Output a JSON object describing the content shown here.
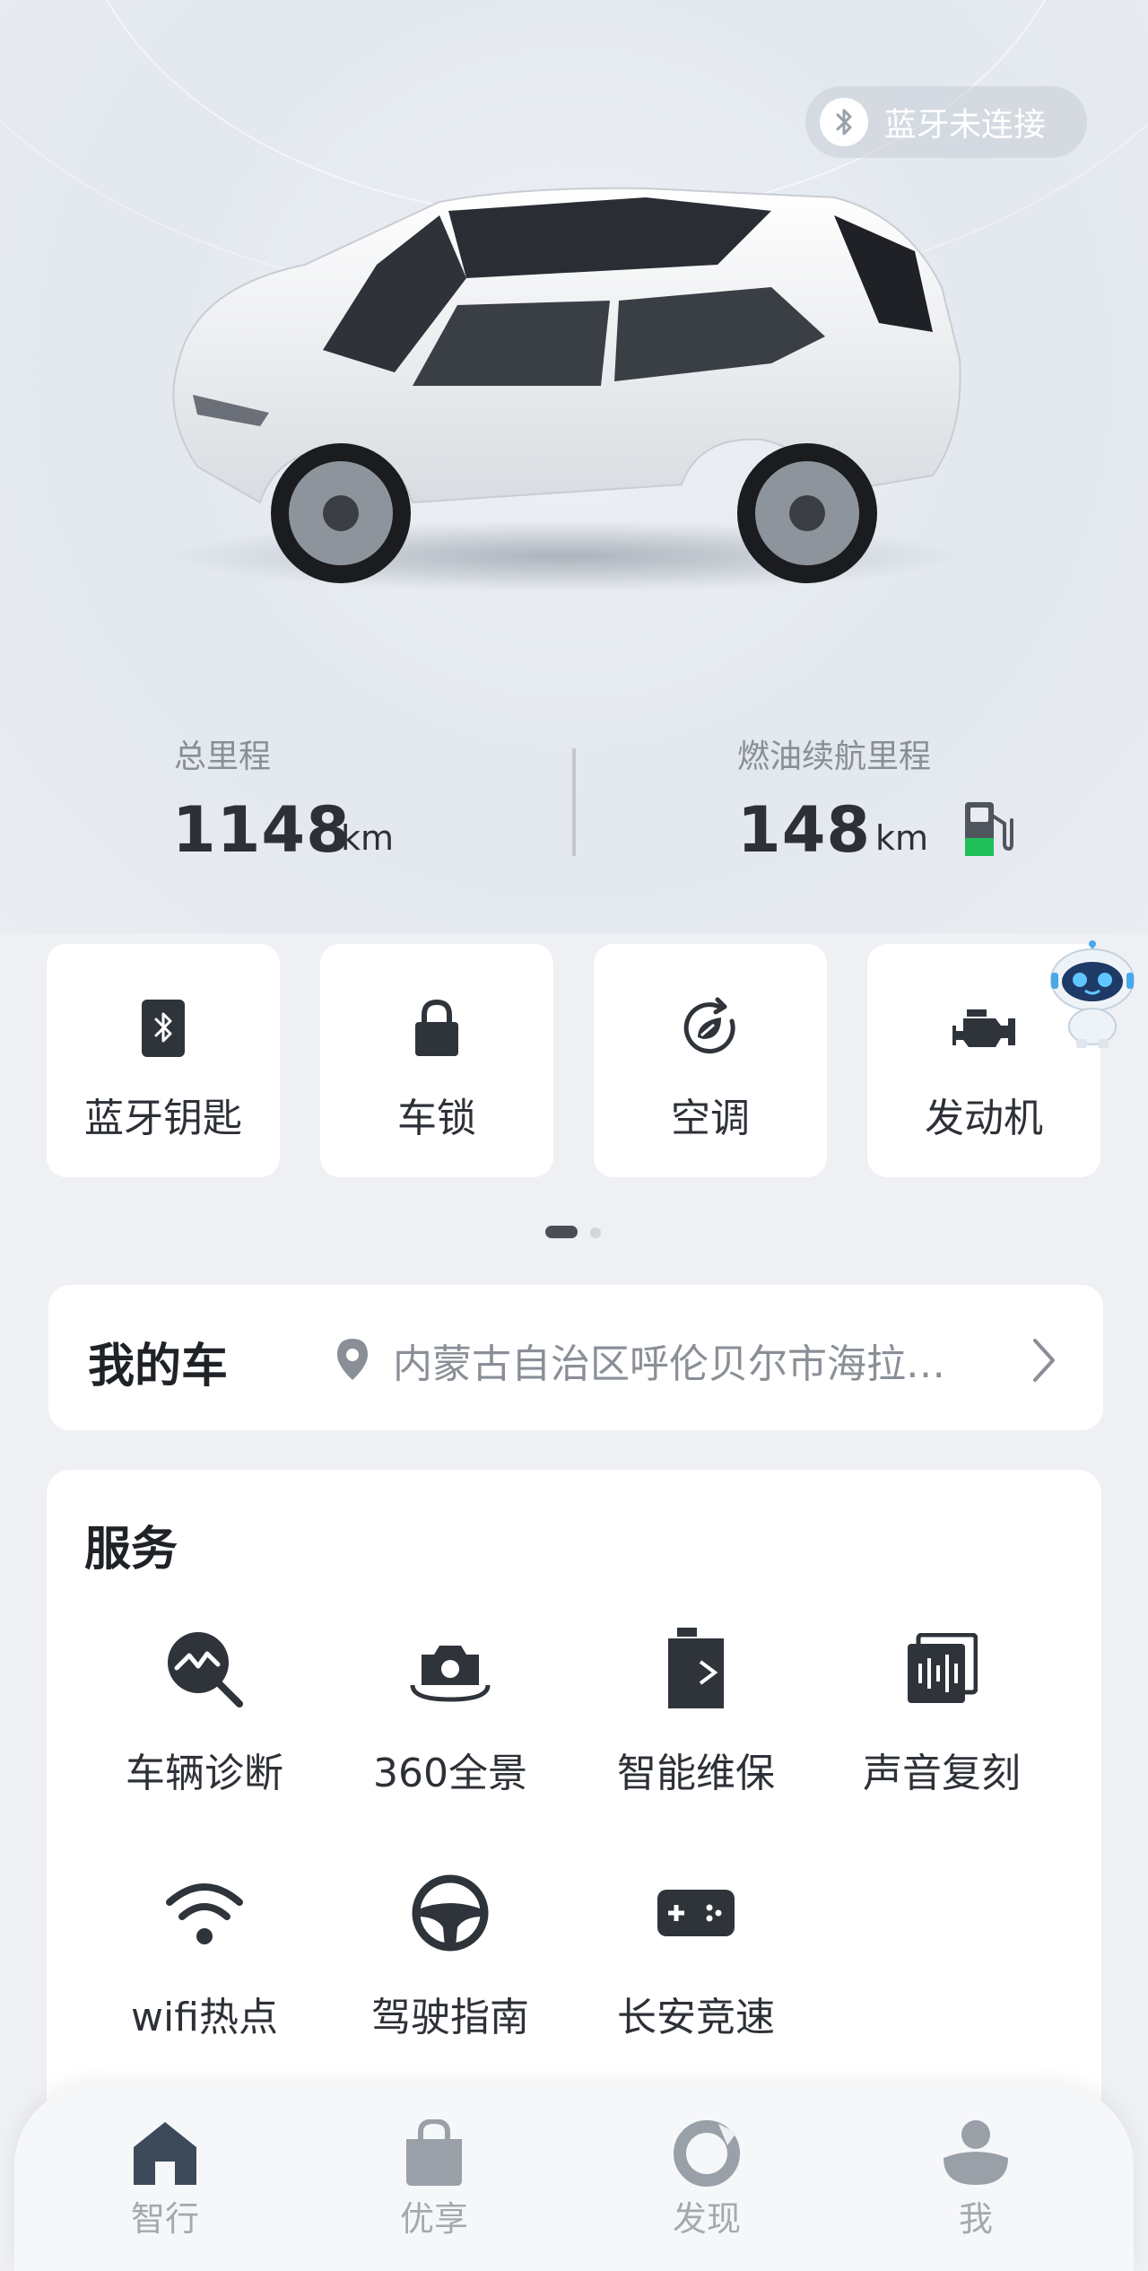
{
  "colors": {
    "accent": "#2d3137",
    "fuel_green": "#1fbf5a",
    "muted": "#8a8f97"
  },
  "bluetooth_status": {
    "label": "蓝牙未连接",
    "icon": "bluetooth-icon"
  },
  "stats": {
    "total_mileage": {
      "label": "总里程",
      "value": "1148",
      "unit": "km"
    },
    "fuel_range": {
      "label": "燃油续航里程",
      "value": "148",
      "unit": "km",
      "icon": "fuel-pump-icon"
    }
  },
  "quick_controls": [
    {
      "label": "蓝牙钥匙",
      "icon": "bluetooth-key-icon"
    },
    {
      "label": "车锁",
      "icon": "lock-icon"
    },
    {
      "label": "空调",
      "icon": "air-conditioner-icon"
    },
    {
      "label": "发动机",
      "icon": "engine-icon"
    }
  ],
  "pager": {
    "current": 1,
    "total": 2
  },
  "my_car": {
    "title": "我的车",
    "location": "内蒙古自治区呼伦贝尔市海拉…"
  },
  "services": {
    "title": "服务",
    "items": [
      {
        "label": "车辆诊断",
        "icon": "diagnosis-icon"
      },
      {
        "label": "360全景",
        "icon": "panorama-camera-icon"
      },
      {
        "label": "智能维保",
        "icon": "maintenance-icon"
      },
      {
        "label": "声音复刻",
        "icon": "voice-clone-icon"
      },
      {
        "label": "wifi热点",
        "icon": "wifi-icon"
      },
      {
        "label": "驾驶指南",
        "icon": "steering-wheel-icon"
      },
      {
        "label": "长安竞速",
        "icon": "gamepad-icon"
      }
    ]
  },
  "tabbar": {
    "active": "智行",
    "items": [
      {
        "label": "智行",
        "icon": "home-icon"
      },
      {
        "label": "优享",
        "icon": "shopping-bag-icon"
      },
      {
        "label": "发现",
        "icon": "discover-icon"
      },
      {
        "label": "我",
        "icon": "profile-icon"
      }
    ]
  }
}
